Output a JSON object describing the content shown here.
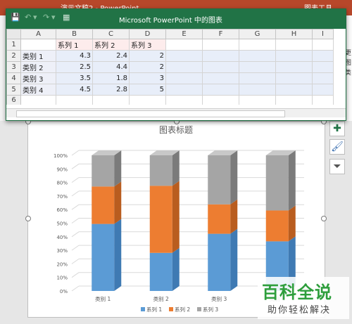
{
  "ppt": {
    "title": "演示文稿2 - PowerPoint",
    "tools_label": "图表工具",
    "right_strip": [
      "更",
      "图",
      "类"
    ]
  },
  "excel": {
    "title": "Microsoft PowerPoint 中的图表",
    "columns": [
      "",
      "A",
      "B",
      "C",
      "D",
      "E",
      "F",
      "G",
      "H",
      "I"
    ],
    "rows": [
      [
        "1",
        "",
        "系列 1",
        "系列 2",
        "系列 3",
        "",
        "",
        "",
        "",
        ""
      ],
      [
        "2",
        "类别 1",
        "4.3",
        "2.4",
        "2",
        "",
        "",
        "",
        "",
        ""
      ],
      [
        "3",
        "类别 2",
        "2.5",
        "4.4",
        "2",
        "",
        "",
        "",
        "",
        ""
      ],
      [
        "4",
        "类别 3",
        "3.5",
        "1.8",
        "3",
        "",
        "",
        "",
        "",
        ""
      ],
      [
        "5",
        "类别 4",
        "4.5",
        "2.8",
        "5",
        "",
        "",
        "",
        "",
        ""
      ],
      [
        "6",
        "",
        "",
        "",
        "",
        "",
        "",
        "",
        "",
        ""
      ],
      [
        "7",
        "",
        "",
        "",
        "",
        "",
        "",
        "",
        "",
        ""
      ]
    ]
  },
  "chart_data": {
    "type": "bar",
    "stacked": "percent",
    "title": "图表标题",
    "categories": [
      "类别 1",
      "类别 2",
      "类别 3",
      "类别 4"
    ],
    "series": [
      {
        "name": "系列 1",
        "values": [
          4.3,
          2.5,
          3.5,
          4.5
        ],
        "color": "#5b9bd5",
        "side": "#3f7ab3",
        "top": "#8ab8e4"
      },
      {
        "name": "系列 2",
        "values": [
          2.4,
          4.4,
          1.8,
          2.8
        ],
        "color": "#ed7d31",
        "side": "#b95d1f",
        "top": "#f4a26b"
      },
      {
        "name": "系列 3",
        "values": [
          2,
          2,
          3,
          5
        ],
        "color": "#a5a5a5",
        "side": "#7b7b7b",
        "top": "#c8c8c8"
      }
    ],
    "yticks": [
      "0%",
      "10%",
      "20%",
      "30%",
      "40%",
      "50%",
      "60%",
      "70%",
      "80%",
      "90%",
      "100%"
    ],
    "ylim": [
      0,
      100
    ],
    "legend_position": "bottom",
    "grid": true
  },
  "side_tools": [
    {
      "icon": "plus-icon",
      "glyph": "✚",
      "color": "#217346"
    },
    {
      "icon": "brush-icon",
      "glyph": "🖌",
      "color": "#3a6fb0"
    },
    {
      "icon": "filter-icon",
      "glyph": "⏷",
      "color": "#555555"
    }
  ],
  "watermark": {
    "title": "百科全说",
    "subtitle": "助你轻松解决"
  }
}
